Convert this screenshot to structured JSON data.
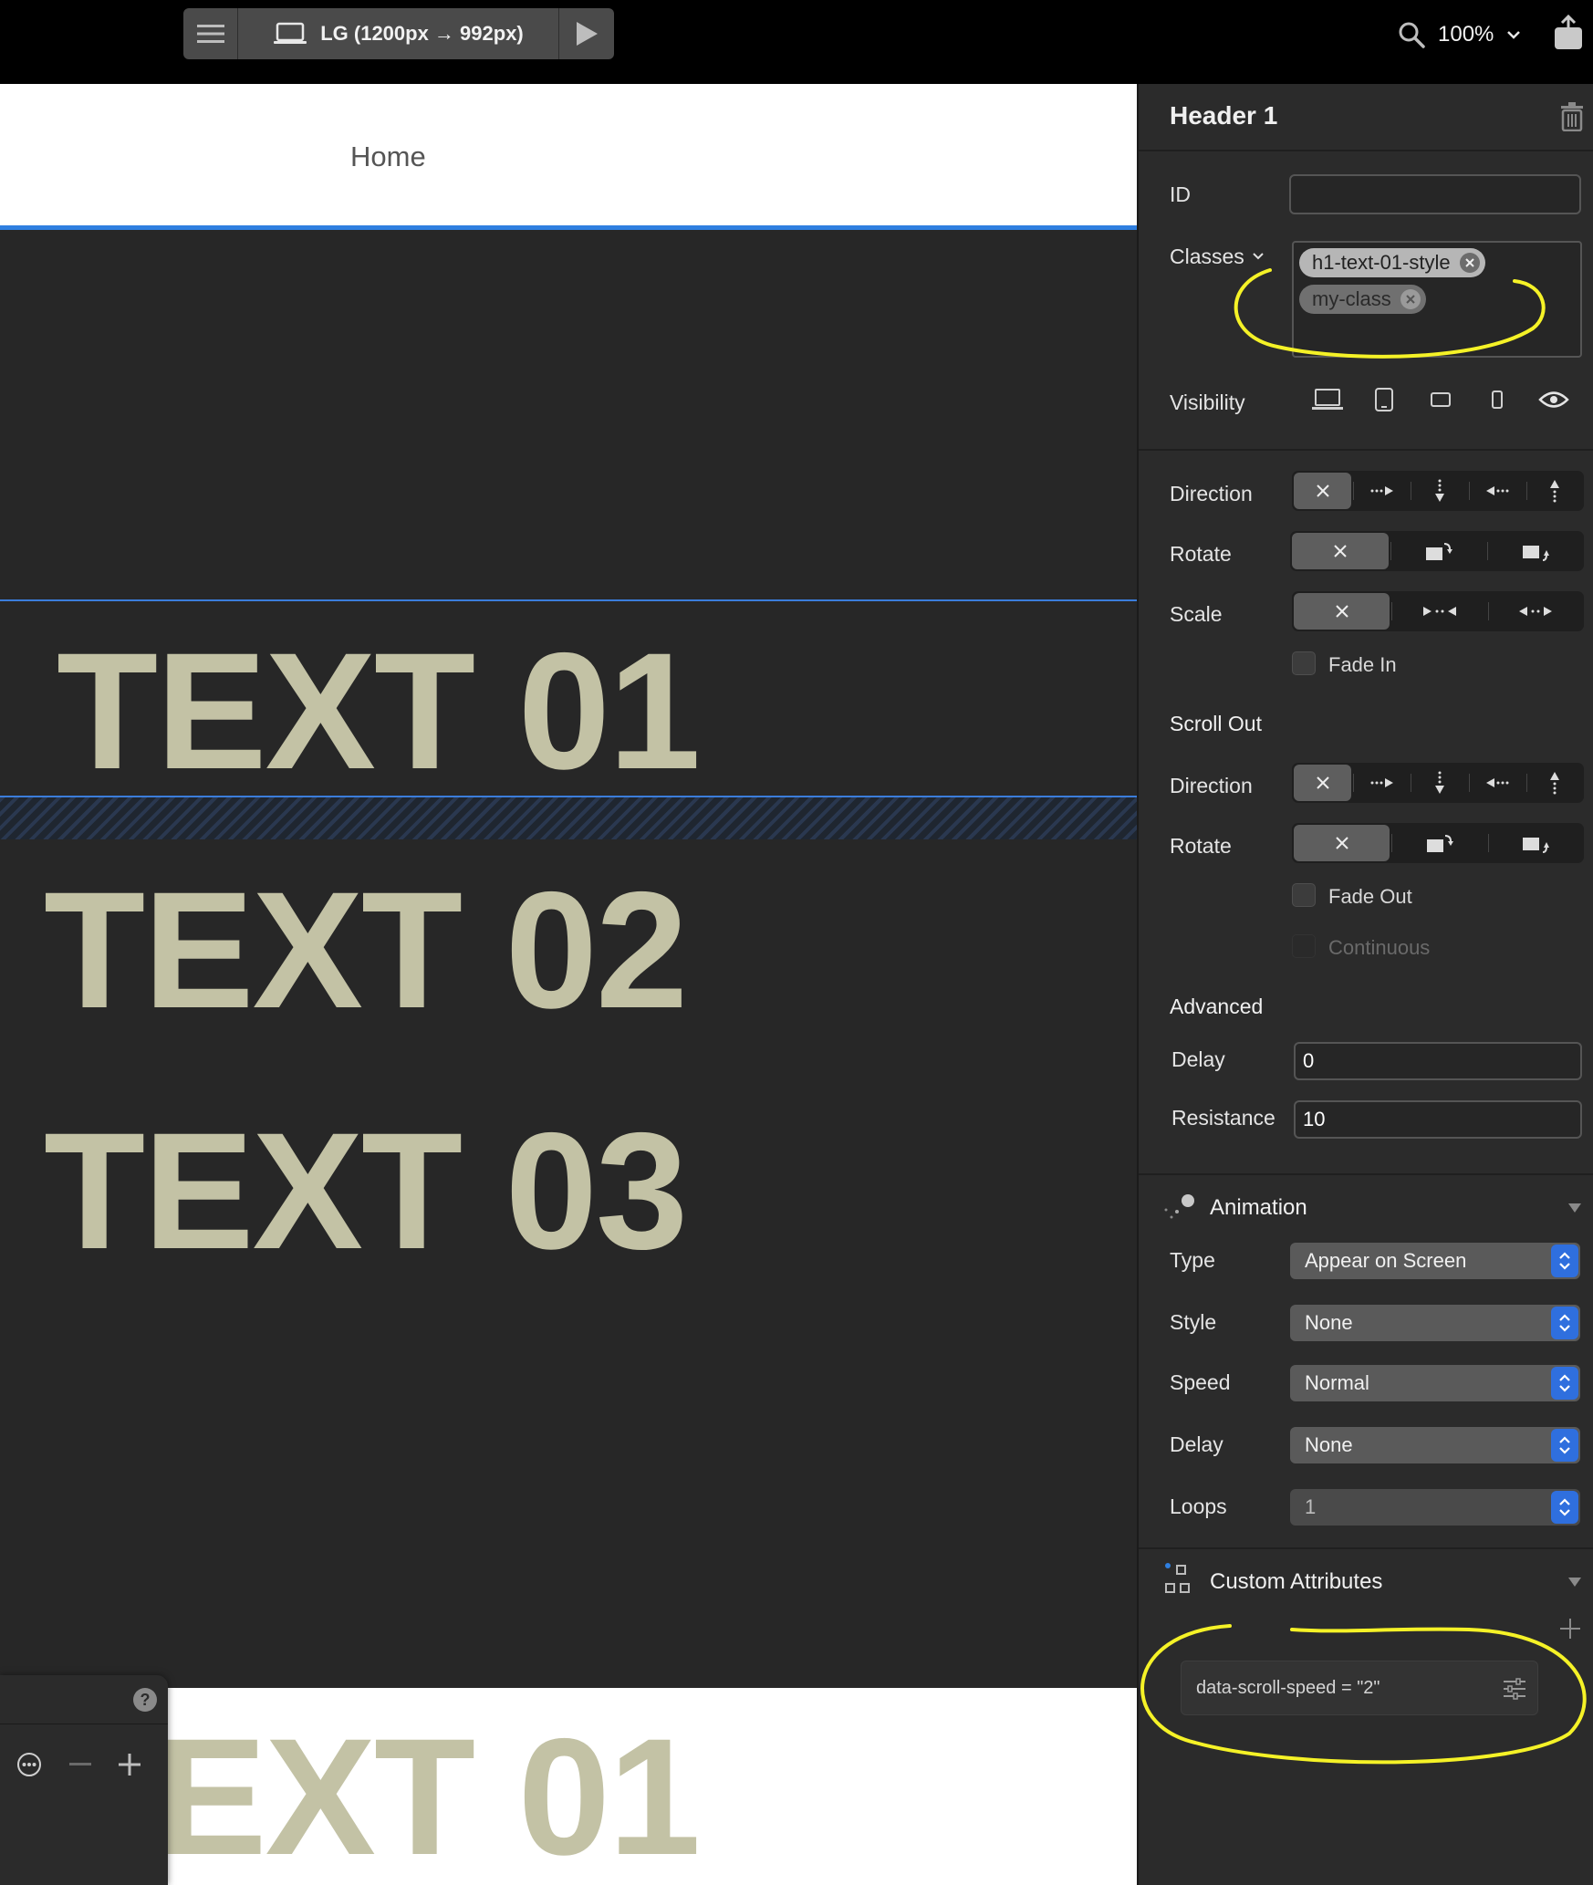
{
  "toolbar": {
    "device_label": "LG (1200px → 992px)",
    "zoom_label": "100%"
  },
  "canvas": {
    "nav_home": "Home",
    "texts": [
      "TEXT 01",
      "TEXT 02",
      "TEXT 03"
    ],
    "bottom_text": "TEXT 01",
    "help_label": "?"
  },
  "inspector": {
    "title": "Header 1",
    "id_label": "ID",
    "id_value": "",
    "classes_label": "Classes",
    "classes": [
      "h1-text-01-style",
      "my-class"
    ],
    "visibility_label": "Visibility",
    "scroll_in": {
      "direction_label": "Direction",
      "rotate_label": "Rotate",
      "scale_label": "Scale",
      "fade_in_label": "Fade In"
    },
    "scroll_out": {
      "title": "Scroll Out",
      "direction_label": "Direction",
      "rotate_label": "Rotate",
      "fade_out_label": "Fade Out",
      "continuous_label": "Continuous"
    },
    "advanced": {
      "title": "Advanced",
      "delay_label": "Delay",
      "delay_value": "0",
      "resistance_label": "Resistance",
      "resistance_value": "10"
    },
    "animation": {
      "title": "Animation",
      "type_label": "Type",
      "type_value": "Appear on Screen",
      "style_label": "Style",
      "style_value": "None",
      "speed_label": "Speed",
      "speed_value": "Normal",
      "delay_label": "Delay",
      "delay_value": "None",
      "loops_label": "Loops",
      "loops_value": "1"
    },
    "custom_attributes": {
      "title": "Custom Attributes",
      "items": [
        "data-scroll-speed = \"2\""
      ]
    }
  },
  "colors": {
    "accent_blue": "#2f7fe0",
    "highlight_yellow": "#f5f227",
    "canvas_text": "#c3c2a5"
  }
}
